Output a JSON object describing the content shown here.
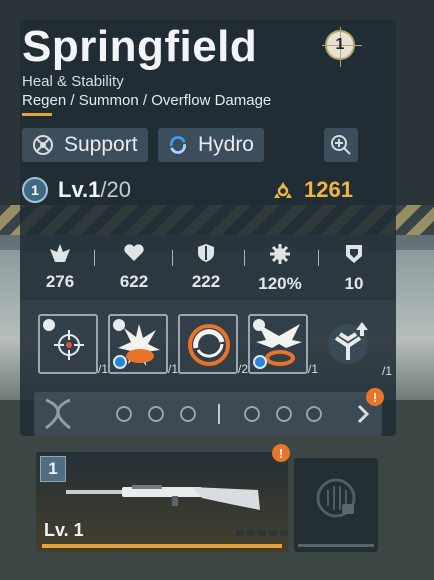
{
  "character": {
    "name": "Springfield",
    "rank": "1",
    "role": "Heal & Stability",
    "skills": "Regen / Summon / Overflow Damage"
  },
  "tags": {
    "class_label": "Support",
    "element_label": "Hydro"
  },
  "level": {
    "current": "Lv.1",
    "max": "/20",
    "badge": "1"
  },
  "combat_power": "1261",
  "stats": [
    {
      "icon": "attack-icon",
      "value": "276"
    },
    {
      "icon": "health-icon",
      "value": "622"
    },
    {
      "icon": "defense-icon",
      "value": "222"
    },
    {
      "icon": "crit-gear-icon",
      "value": "120%"
    },
    {
      "icon": "shield-stability-icon",
      "value": "10"
    }
  ],
  "equipment": [
    {
      "name": "crosshair",
      "count": "/1"
    },
    {
      "name": "explosion",
      "count": "/1"
    },
    {
      "name": "hydro-swirl",
      "count": "/2"
    },
    {
      "name": "eagle",
      "count": "/1"
    },
    {
      "name": "upgrade",
      "count": "/1"
    }
  ],
  "weapon": {
    "rank": "1",
    "level": "Lv. 1"
  },
  "colors": {
    "accent": "#e7a13a",
    "power": "#f0b63e",
    "alert": "#e9742a",
    "hydro": "#2b84d8"
  }
}
